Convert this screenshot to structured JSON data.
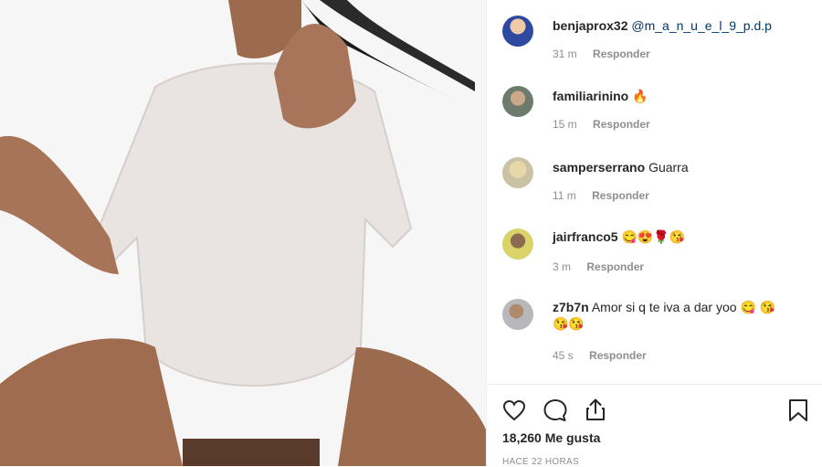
{
  "comments": [
    {
      "username": "benjaprox32",
      "text": "",
      "mention": "@m_a_n_u_e_l_9_p.d.p",
      "time": "31 m",
      "reply": "Responder"
    },
    {
      "username": "familiarinino",
      "text": "🔥",
      "mention": "",
      "time": "15 m",
      "reply": "Responder"
    },
    {
      "username": "samperserrano",
      "text": "Guarra",
      "mention": "",
      "time": "11 m",
      "reply": "Responder"
    },
    {
      "username": "jairfranco5",
      "text": "😋😍🌹😘",
      "mention": "",
      "time": "3 m",
      "reply": "Responder"
    },
    {
      "username": "z7b7n",
      "text": "Amor si q te iva a dar yoo 😋 😘😘😘",
      "mention": "",
      "time": "45 s",
      "reply": "Responder"
    }
  ],
  "post": {
    "likes": "18,260 Me gusta",
    "timestamp": "HACE 22 HORAS"
  },
  "icons": [
    "heart-icon",
    "comment-icon",
    "share-icon",
    "bookmark-icon"
  ],
  "colors": {
    "text": "#262626",
    "muted": "#8e8e8e",
    "mention": "#00376b",
    "divider": "#efefef"
  }
}
